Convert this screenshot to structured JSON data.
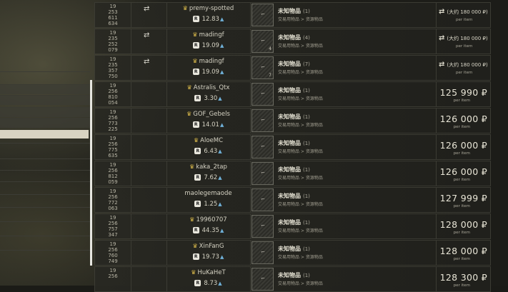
{
  "colors": {
    "accent_crown": "#d8b84a",
    "rep_arrow": "#6fb0d8",
    "selected_band": "#d8d3c2",
    "text": "#e8e5d6"
  },
  "offers": [
    {
      "id": [
        "19",
        "253",
        "611",
        "634"
      ],
      "swap": true,
      "trader": "premy-spotted",
      "crown": true,
      "rep": "12.83",
      "item_name": "未知物品",
      "item_qty": "(1)",
      "item_sub": "交易用物品 > 资源物品",
      "item_count": "",
      "price": "(大约 180 000 ₽)",
      "bundle": true,
      "per_item": "per item"
    },
    {
      "id": [
        "19",
        "235",
        "252",
        "079"
      ],
      "swap": true,
      "trader": "madingf",
      "crown": true,
      "rep": "19.09",
      "item_name": "未知物品",
      "item_qty": "(4)",
      "item_sub": "交易用物品 > 资源物品",
      "item_count": "4",
      "price": "(大约 180 000 ₽)",
      "bundle": true,
      "per_item": "per item"
    },
    {
      "id": [
        "19",
        "235",
        "357",
        "750"
      ],
      "swap": true,
      "trader": "madingf",
      "crown": true,
      "rep": "19.09",
      "item_name": "未知物品",
      "item_qty": "(7)",
      "item_sub": "交易用物品 > 资源物品",
      "item_count": "7",
      "price": "(大约 180 000 ₽)",
      "bundle": true,
      "per_item": "per item"
    },
    {
      "id": [
        "19",
        "256",
        "810",
        "054"
      ],
      "swap": false,
      "trader": "Astralis_Qtx",
      "crown": true,
      "rep": "3.30",
      "item_name": "未知物品",
      "item_qty": "(1)",
      "item_sub": "交易用物品 > 资源物品",
      "item_count": "",
      "price": "125 990 ₽",
      "bundle": false,
      "per_item": "per item"
    },
    {
      "id": [
        "19",
        "256",
        "773",
        "225"
      ],
      "swap": false,
      "trader": "GOF_Gebels",
      "crown": true,
      "rep": "14.01",
      "item_name": "未知物品",
      "item_qty": "(1)",
      "item_sub": "交易用物品 > 资源物品",
      "item_count": "",
      "price": "126 000 ₽",
      "bundle": false,
      "per_item": "per item"
    },
    {
      "id": [
        "19",
        "256",
        "775",
        "635"
      ],
      "swap": false,
      "trader": "AloeMC",
      "crown": true,
      "rep": "6.43",
      "item_name": "未知物品",
      "item_qty": "(1)",
      "item_sub": "交易用物品 > 资源物品",
      "item_count": "",
      "price": "126 000 ₽",
      "bundle": false,
      "per_item": "per item"
    },
    {
      "id": [
        "19",
        "256",
        "812",
        "059"
      ],
      "swap": false,
      "trader": "kaka_2tap",
      "crown": true,
      "rep": "7.62",
      "item_name": "未知物品",
      "item_qty": "(1)",
      "item_sub": "交易用物品 > 资源物品",
      "item_count": "",
      "price": "126 000 ₽",
      "bundle": false,
      "per_item": "per item"
    },
    {
      "id": [
        "19",
        "256",
        "772",
        "063"
      ],
      "swap": false,
      "trader": "maolegemaode",
      "crown": false,
      "rep": "1.25",
      "item_name": "未知物品",
      "item_qty": "(1)",
      "item_sub": "交易用物品 > 资源物品",
      "item_count": "",
      "price": "127 999 ₽",
      "bundle": false,
      "per_item": "per item"
    },
    {
      "id": [
        "19",
        "256",
        "757",
        "347"
      ],
      "swap": false,
      "trader": "19960707",
      "crown": true,
      "rep": "44.35",
      "item_name": "未知物品",
      "item_qty": "(1)",
      "item_sub": "交易用物品 > 资源物品",
      "item_count": "",
      "price": "128 000 ₽",
      "bundle": false,
      "per_item": "per item"
    },
    {
      "id": [
        "19",
        "256",
        "760",
        "749"
      ],
      "swap": false,
      "trader": "XinFanG",
      "crown": true,
      "rep": "19.73",
      "item_name": "未知物品",
      "item_qty": "(1)",
      "item_sub": "交易用物品 > 资源物品",
      "item_count": "",
      "price": "128 000 ₽",
      "bundle": false,
      "per_item": "per item"
    },
    {
      "id": [
        "19",
        "256"
      ],
      "swap": false,
      "trader": "HuKaHeT",
      "crown": true,
      "rep": "8.73",
      "item_name": "未知物品",
      "item_qty": "(1)",
      "item_sub": "交易用物品 > 资源物品",
      "item_count": "",
      "price": "128 300 ₽",
      "bundle": false,
      "per_item": "per item"
    }
  ]
}
